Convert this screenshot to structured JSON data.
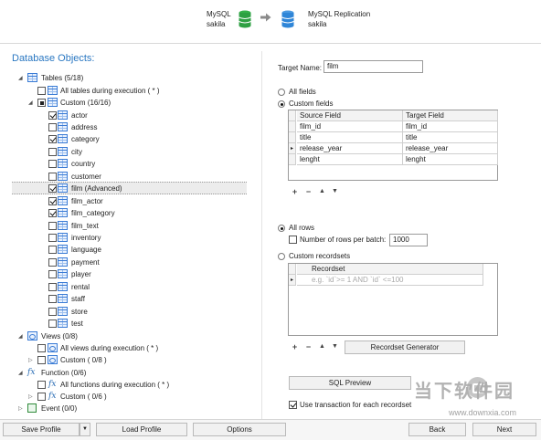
{
  "header": {
    "source_name": "MySQL",
    "source_db": "sakila",
    "target_name": "MySQL Replication",
    "target_db": "sakila",
    "source_icon": "green-database-icon",
    "target_icon": "blue-database-icon",
    "arrow_icon": "right-arrow-icon",
    "colors": {
      "source": "#2ea043",
      "target": "#2f86d8"
    }
  },
  "left": {
    "title": "Database Objects:",
    "tables": {
      "label": "Tables (5/18)",
      "all_label": "All tables during execution ( * )",
      "custom_label": "Custom (16/16)",
      "items": [
        {
          "name": "actor",
          "checked": true
        },
        {
          "name": "address",
          "checked": false
        },
        {
          "name": "category",
          "checked": true
        },
        {
          "name": "city",
          "checked": false
        },
        {
          "name": "country",
          "checked": false
        },
        {
          "name": "customer",
          "checked": false
        },
        {
          "name": "film (Advanced)",
          "checked": true
        },
        {
          "name": "film_actor",
          "checked": true
        },
        {
          "name": "film_category",
          "checked": true
        },
        {
          "name": "film_text",
          "checked": false
        },
        {
          "name": "inventory",
          "checked": false
        },
        {
          "name": "language",
          "checked": false
        },
        {
          "name": "payment",
          "checked": false
        },
        {
          "name": "player",
          "checked": false
        },
        {
          "name": "rental",
          "checked": false
        },
        {
          "name": "staff",
          "checked": false
        },
        {
          "name": "store",
          "checked": false
        },
        {
          "name": "test",
          "checked": false
        }
      ]
    },
    "views": {
      "label": "Views (0/8)",
      "all_label": "All views during execution ( * )",
      "custom_label": "Custom ( 0/8 )"
    },
    "functions": {
      "label": "Function (0/6)",
      "all_label": "All functions during execution ( * )",
      "custom_label": "Custom ( 0/6 )"
    },
    "events": {
      "label": "Event (0/0)"
    }
  },
  "right": {
    "target_name_label": "Target Name:",
    "target_name_value": "film",
    "all_fields_label": "All fields",
    "custom_fields_label": "Custom fields",
    "fields_grid": {
      "headers": [
        "Source Field",
        "Target Field"
      ],
      "rows": [
        [
          "film_id",
          "film_id"
        ],
        [
          "title",
          "title"
        ],
        [
          "release_year",
          "release_year"
        ],
        [
          "lenght",
          "lenght"
        ]
      ]
    },
    "all_rows_label": "All rows",
    "rows_per_batch_label": "Number of rows per batch:",
    "rows_per_batch_value": "1000",
    "custom_recordsets_label": "Custom recordsets",
    "recordset_header": "Recordset",
    "recordset_placeholder": "e.g. `id`>= 1 AND `id` <=100",
    "recordset_generator_label": "Recordset Generator",
    "sql_preview_label": "SQL Preview",
    "use_transaction_label": "Use transaction for each recordset"
  },
  "bottom": {
    "save_profile": "Save Profile",
    "load_profile": "Load Profile",
    "options": "Options",
    "back": "Back",
    "next": "Next"
  },
  "watermark": {
    "cn_text": "当下软件园",
    "url": "www.downxia.com"
  }
}
